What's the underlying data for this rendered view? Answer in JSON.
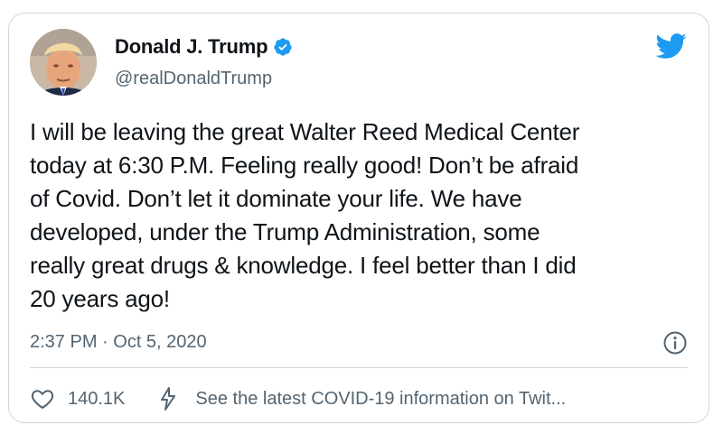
{
  "tweet": {
    "author": {
      "display_name": "Donald J. Trump",
      "handle": "@realDonaldTrump",
      "verified": true,
      "avatar_icon": "profile-photo"
    },
    "brand_icon": "twitter-bird-icon",
    "brand_color": "#1d9bf0",
    "text_lines": [
      "I will be leaving the great Walter Reed Medical Center",
      "today at 6:30 P.M. Feeling really good! Don’t be afraid",
      "of Covid. Don’t let it dominate your life. We have",
      "developed, under the Trump Administration, some",
      "really great drugs & knowledge. I feel better than I did",
      "20 years ago!"
    ],
    "timestamp": "2:37 PM · Oct 5, 2020",
    "info_icon": "info-circle-icon",
    "likes": "140.1K",
    "like_icon": "heart-icon",
    "covid_icon": "lightning-bolt-icon",
    "covid_link": "See the latest COVID-19 information on Twit..."
  }
}
